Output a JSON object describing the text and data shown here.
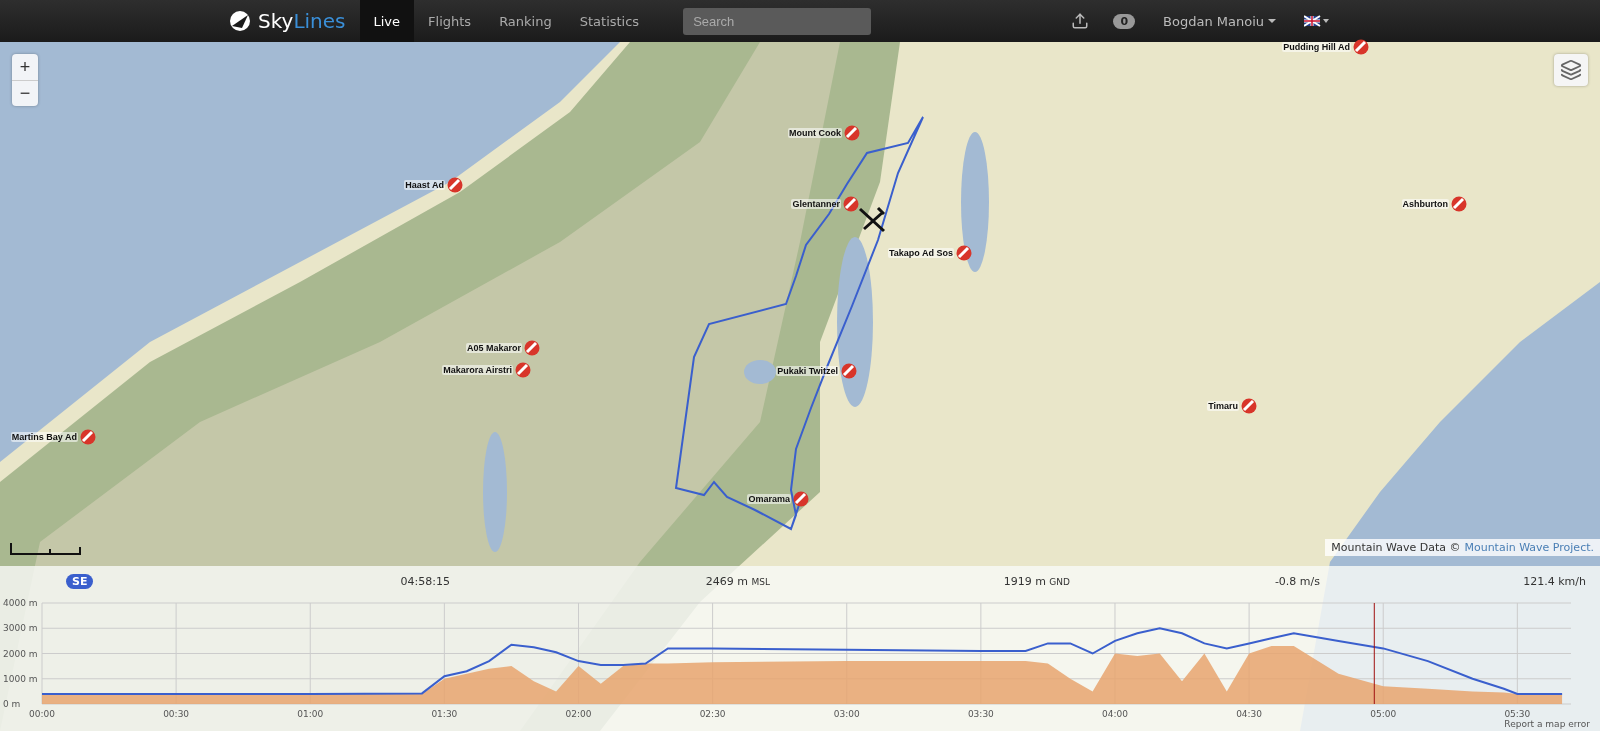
{
  "nav": {
    "logo": {
      "part_1": "Sky",
      "part_2": "Lines"
    },
    "tabs": [
      {
        "label": "Live",
        "selected": true
      },
      {
        "label": "Flights",
        "selected": false
      },
      {
        "label": "Ranking",
        "selected": false
      },
      {
        "label": "Statistics",
        "selected": false
      }
    ],
    "search": {
      "placeholder": "Search"
    },
    "notifications": "0",
    "user": "Bogdan Manoiu"
  },
  "map": {
    "zoom_in": "+",
    "zoom_out": "−",
    "airfields": [
      {
        "name": "Pudding Hill Ad"
      },
      {
        "name": "Mount Cook"
      },
      {
        "name": "Haast Ad"
      },
      {
        "name": "Glentanner"
      },
      {
        "name": "Ashburton"
      },
      {
        "name": "Takapo Ad Sos"
      },
      {
        "name": "A05 Makaror"
      },
      {
        "name": "Makarora Airstri"
      },
      {
        "name": "Pukaki Twitzel"
      },
      {
        "name": "Timaru"
      },
      {
        "name": "Martins Bay Ad"
      },
      {
        "name": "Omarama"
      }
    ],
    "attribution": {
      "text": "Mountain Wave Data ©",
      "link": "Mountain Wave Project."
    },
    "map_error_link": "Report a map error"
  },
  "barogram": {
    "direction": "SE",
    "time": "04:58:15",
    "altitude": {
      "value": "2469 m",
      "unit": "MSL"
    },
    "height": {
      "value": "1919 m",
      "unit": "GND"
    },
    "vario": "-0.8 m/s",
    "speed": "121.4 km/h",
    "chart_data": {
      "type": "line",
      "x": [
        0,
        30,
        60,
        85,
        90,
        95,
        100,
        105,
        110,
        115,
        120,
        125,
        130,
        135,
        140,
        150,
        180,
        210,
        220,
        225,
        230,
        235,
        240,
        245,
        250,
        255,
        260,
        265,
        270,
        275,
        280,
        290,
        300,
        310,
        320,
        327,
        330,
        340
      ],
      "series": [
        {
          "type": "line",
          "color": "#3a5fcd",
          "values": [
            400,
            400,
            400,
            420,
            1100,
            1300,
            1700,
            2350,
            2250,
            2050,
            1700,
            1550,
            1550,
            1600,
            2200,
            2200,
            2150,
            2100,
            2100,
            2400,
            2400,
            2000,
            2500,
            2800,
            3000,
            2800,
            2400,
            2200,
            2400,
            2600,
            2800,
            2500,
            2200,
            1700,
            1000,
            600,
            400,
            400
          ]
        },
        {
          "type": "area",
          "color": "#e8a46f",
          "values": [
            400,
            400,
            400,
            400,
            1000,
            1200,
            1400,
            1500,
            900,
            500,
            1500,
            800,
            1500,
            1600,
            1600,
            1650,
            1700,
            1700,
            1700,
            1600,
            1000,
            500,
            2000,
            1900,
            2000,
            900,
            2000,
            500,
            2000,
            2300,
            2300,
            1200,
            700,
            600,
            500,
            450,
            400,
            400
          ]
        }
      ],
      "xlim": [
        0,
        342
      ],
      "ylim": [
        0,
        4000
      ],
      "xticks": [
        {
          "value": 0,
          "label": "00:00"
        },
        {
          "value": 30,
          "label": "00:30"
        },
        {
          "value": 60,
          "label": "01:00"
        },
        {
          "value": 90,
          "label": "01:30"
        },
        {
          "value": 120,
          "label": "02:00"
        },
        {
          "value": 150,
          "label": "02:30"
        },
        {
          "value": 180,
          "label": "03:00"
        },
        {
          "value": 210,
          "label": "03:30"
        },
        {
          "value": 240,
          "label": "04:00"
        },
        {
          "value": 270,
          "label": "04:30"
        },
        {
          "value": 300,
          "label": "05:00"
        },
        {
          "value": 330,
          "label": "05:30"
        }
      ],
      "yticks": [
        {
          "value": 0,
          "label": "0 m"
        },
        {
          "value": 1000,
          "label": "1000 m"
        },
        {
          "value": 2000,
          "label": "2000 m"
        },
        {
          "value": 3000,
          "label": "3000 m"
        },
        {
          "value": 4000,
          "label": "4000 m"
        }
      ],
      "grid": true,
      "ref_lines": [
        {
          "axis": "x",
          "value": 298,
          "color": "#a01010"
        }
      ]
    }
  }
}
